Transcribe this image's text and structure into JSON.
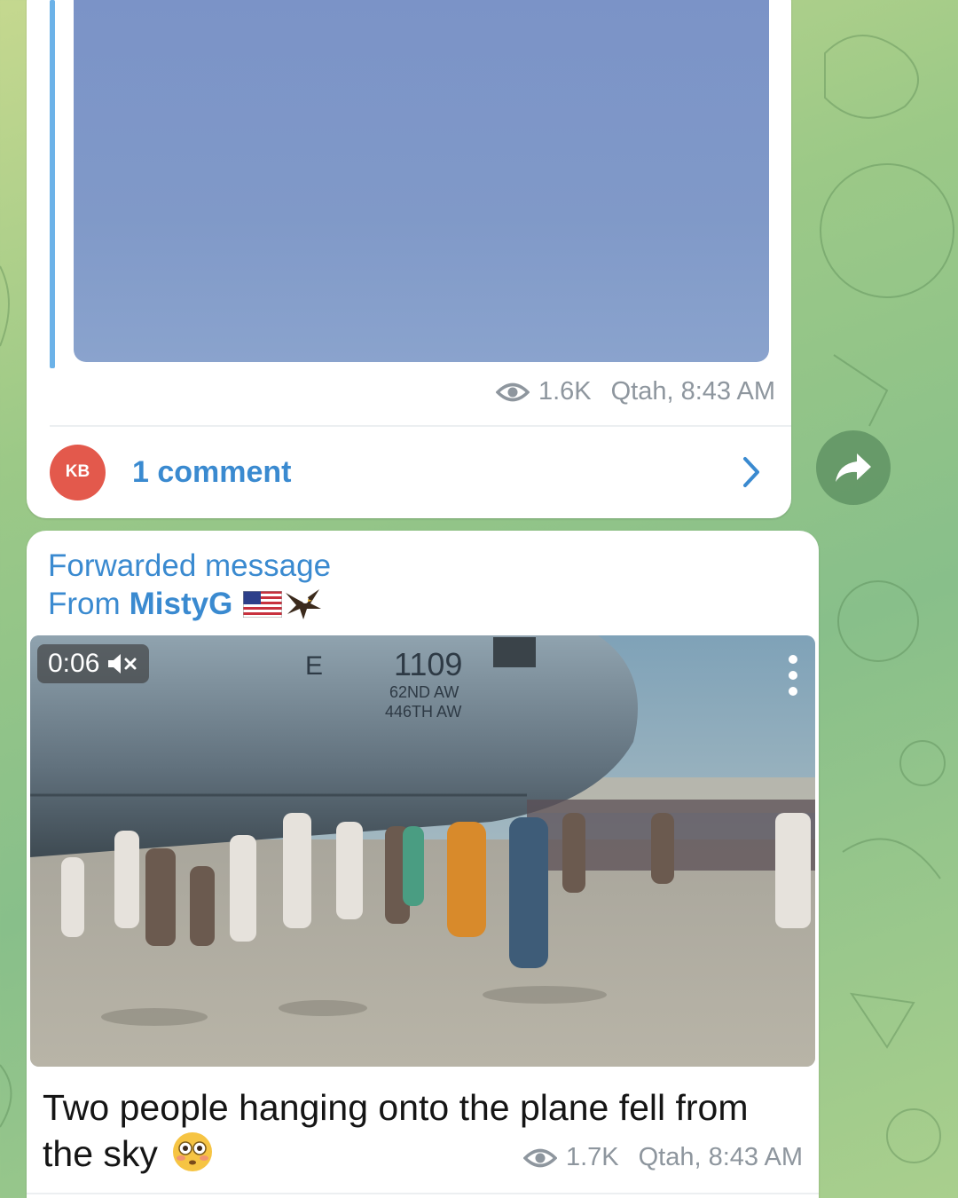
{
  "message1": {
    "views": "1.6K",
    "time": "Qtah, 8:43 AM",
    "comments": {
      "avatar_initials": "KB",
      "avatar_color": "#e3594c",
      "label": "1 comment"
    }
  },
  "message2": {
    "forwarded_label": "Forwarded message",
    "from_prefix": "From",
    "from_name": "MistyG",
    "video": {
      "duration": "0:06",
      "muted": true,
      "plane_text": {
        "tail": "1109",
        "wing1": "62ND AW",
        "wing2": "446TH AW"
      }
    },
    "caption": "Two people hanging onto the plane fell from the sky",
    "views": "1.7K",
    "time": "Qtah, 8:43 AM"
  },
  "colors": {
    "link_blue": "#3a8ad0",
    "meta_gray": "#8e969e",
    "quote_bar": "#6cb2e8"
  },
  "icons": {
    "views": "eye-icon",
    "comments_open": "chevron-right-icon",
    "share": "share-arrow-icon",
    "mute": "volume-muted-icon",
    "menu": "more-vertical-icon",
    "caption_emoji": "flushed-face-emoji"
  }
}
